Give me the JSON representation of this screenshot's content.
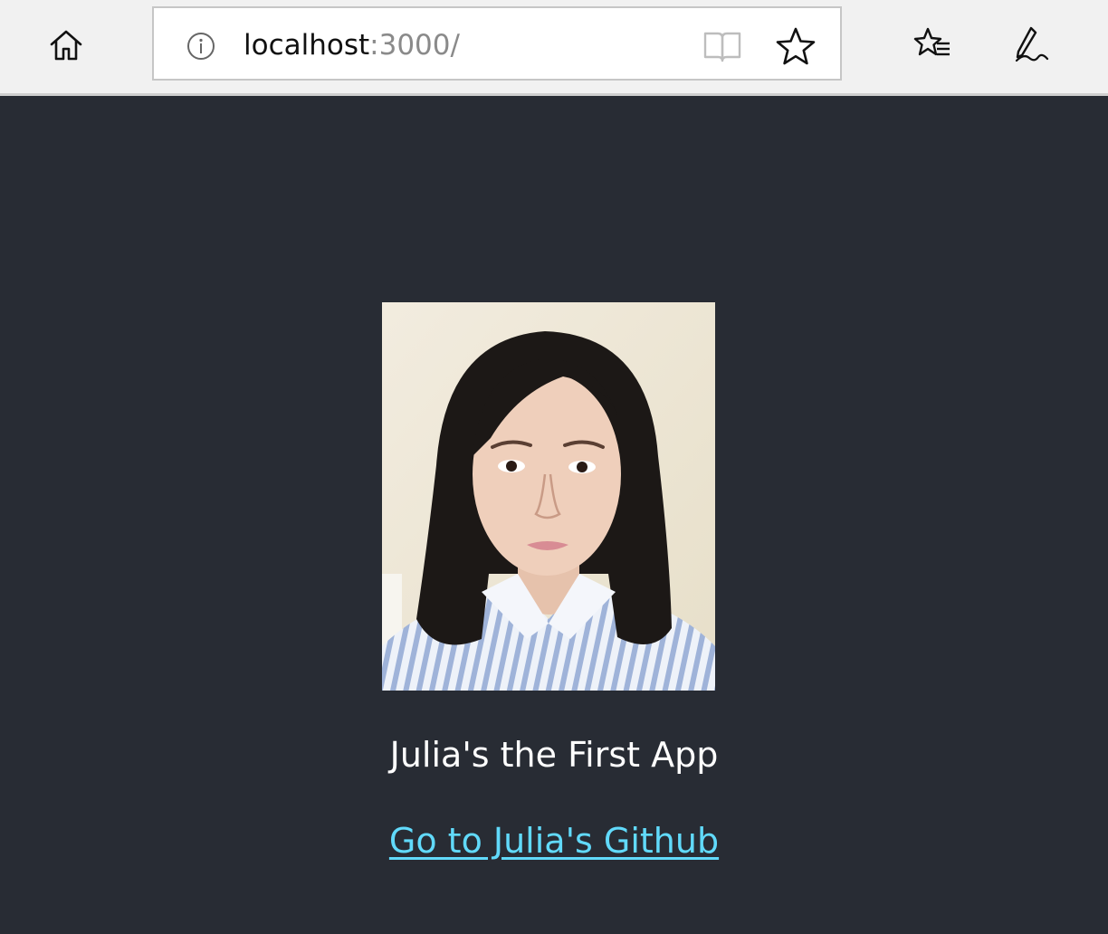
{
  "browser": {
    "url_host": "localhost",
    "url_port": ":3000/",
    "icons": {
      "home": "home-icon",
      "info": "info-icon",
      "reading_view": "reading-view-icon",
      "favorite": "star-icon",
      "favorites_list": "favorites-list-icon",
      "notes": "pen-icon"
    }
  },
  "app": {
    "background": "#282c34",
    "photo_alt": "Profile photo",
    "title": "Julia's the First App",
    "link_label": "Go to Julia's Github",
    "link_color": "#61dafb"
  }
}
